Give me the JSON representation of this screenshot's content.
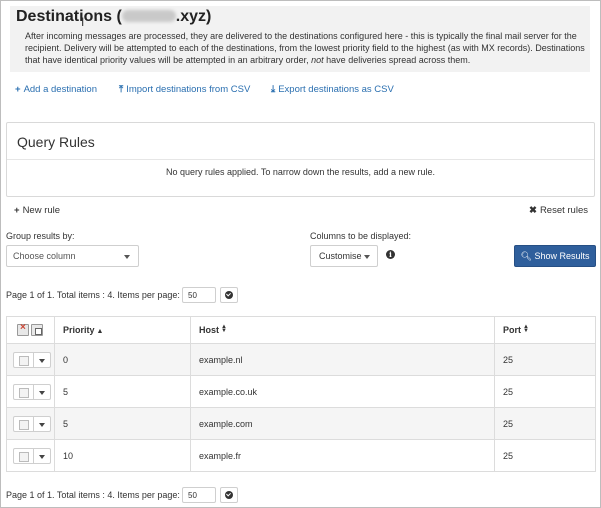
{
  "header": {
    "title": "Destinations (",
    "title_suffix": ".xyz)",
    "description_html": "After incoming messages are processed, they are delivered to the destinations configured here - this is typically the final mail server for the recipient. Delivery will be attempted to each of the destinations, from the lowest priority field to the highest (as with MX records). Destinations that have identical priority values will be attempted in an arbitrary order, <em>not</em> have deliveries spread across them."
  },
  "actions": {
    "add": "Add a destination",
    "import": "Import destinations from CSV",
    "export": "Export destinations as CSV"
  },
  "query": {
    "title": "Query Rules",
    "message": "No query rules applied. To narrow down the results, add a new rule.",
    "new_rule": "New rule",
    "reset_rules": "Reset rules"
  },
  "controls": {
    "group_label": "Group results by:",
    "group_value": "Choose column",
    "columns_label": "Columns to be displayed:",
    "customise": "Customise",
    "show_results": "Show Results"
  },
  "pager": {
    "text": "Page 1 of 1. Total items : 4. Items per page:",
    "items_per_page": "50"
  },
  "table": {
    "headers": {
      "priority": "Priority",
      "host": "Host",
      "port": "Port"
    },
    "rows": [
      {
        "priority": "0",
        "host": "example.nl",
        "port": "25"
      },
      {
        "priority": "5",
        "host": "example.co.uk",
        "port": "25"
      },
      {
        "priority": "5",
        "host": "example.com",
        "port": "25"
      },
      {
        "priority": "10",
        "host": "example.fr",
        "port": "25"
      }
    ]
  },
  "icons": {
    "add": "plus-icon",
    "import": "upload-icon",
    "export": "download-icon",
    "reset": "close-icon",
    "info": "info-icon",
    "search": "search-icon"
  }
}
